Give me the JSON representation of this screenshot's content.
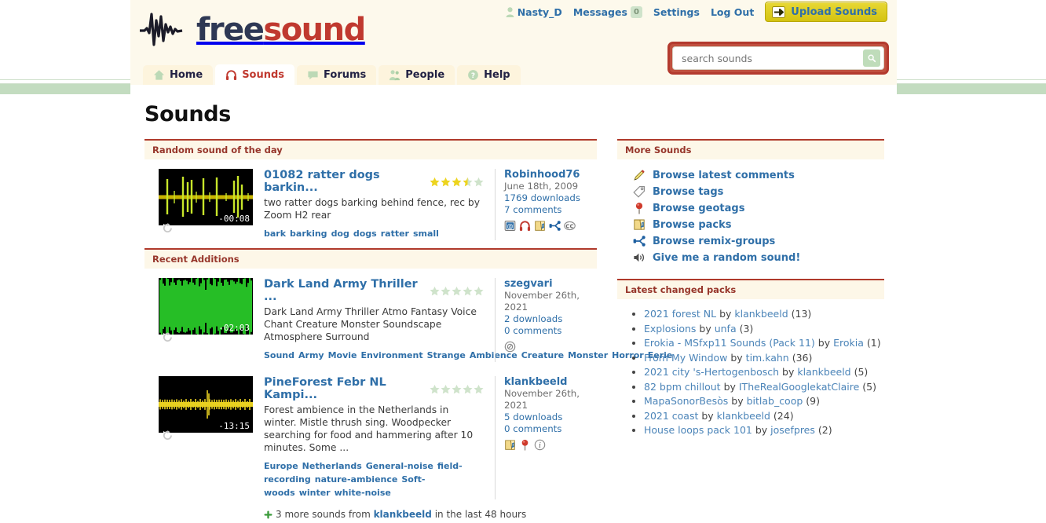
{
  "site": {
    "logo_free": "free",
    "logo_sound": "sound"
  },
  "userbar": {
    "username": "Nasty_D",
    "messages_label": "Messages",
    "messages_count": "0",
    "settings": "Settings",
    "logout": "Log Out",
    "upload": "Upload Sounds"
  },
  "search": {
    "placeholder": "search sounds",
    "value": ""
  },
  "tabs": [
    {
      "label": "Home",
      "icon": "home-icon",
      "active": false
    },
    {
      "label": "Sounds",
      "icon": "headphones-icon",
      "active": true
    },
    {
      "label": "Forums",
      "icon": "speech-bubble-icon",
      "active": false
    },
    {
      "label": "People",
      "icon": "people-icon",
      "active": false
    },
    {
      "label": "Help",
      "icon": "question-mark-icon",
      "active": false
    }
  ],
  "page": {
    "title": "Sounds"
  },
  "random_sound": {
    "section_title": "Random sound of the day",
    "title": "01082 ratter dogs barkin...",
    "rating": 3.5,
    "duration": "-00:08",
    "description": "two ratter dogs barking behind fence, rec by Zoom H2 rear",
    "tags": [
      "bark",
      "barking",
      "dog",
      "dogs",
      "ratter",
      "small"
    ],
    "user": "Robinhood76",
    "date": "June 18th, 2009",
    "downloads": "1769 downloads",
    "comments": "7 comments",
    "icons": [
      "geotag-mail-icon",
      "headphones-icon",
      "pack-icon",
      "remix-icon",
      "creative-commons-icon"
    ]
  },
  "recent_additions": {
    "section_title": "Recent Additions",
    "items": [
      {
        "title": "Dark Land Army Thriller ...",
        "rating": 0,
        "duration": "-02:03",
        "description": "Dark Land Army Thriller Atmo Fantasy Voice Chant Creature Monster Soundscape Atmosphere Surround",
        "tags": [
          "Sound",
          "Army",
          "Movie",
          "Environment",
          "Strange",
          "Ambience",
          "Creature",
          "Monster",
          "Horror",
          "Eerie"
        ],
        "user": "szegvari",
        "date": "November 26th, 2021",
        "downloads": "2 downloads",
        "comments": "0 comments",
        "icons": [
          "creative-commons-zero-icon"
        ],
        "more_sounds": null
      },
      {
        "title": "PineForest Febr NL Kampi...",
        "rating": 0,
        "duration": "-13:15",
        "description": "Forest ambience in the Netherlands in winter. Mistle thrush sing. Woodpecker searching for food and hammering after 10 minutes. Some ...",
        "tags": [
          "Europe",
          "Netherlands",
          "General-noise",
          "field-recording",
          "nature-ambience",
          "Soft-woods",
          "winter",
          "white-noise"
        ],
        "user": "klankbeeld",
        "date": "November 26th, 2021",
        "downloads": "5 downloads",
        "comments": "0 comments",
        "icons": [
          "pack-icon",
          "geotag-pin-icon",
          "info-icon"
        ],
        "more_sounds": {
          "prefix": "3 more sounds from",
          "user": "klankbeeld",
          "suffix": "in the last 48 hours"
        }
      }
    ]
  },
  "more_sounds": {
    "section_title": "More Sounds",
    "items": [
      {
        "label": "Browse latest comments",
        "icon": "pencil-icon"
      },
      {
        "label": "Browse tags",
        "icon": "tag-icon"
      },
      {
        "label": "Browse geotags",
        "icon": "geotag-pin-icon"
      },
      {
        "label": "Browse packs",
        "icon": "pack-icon"
      },
      {
        "label": "Browse remix-groups",
        "icon": "remix-icon"
      },
      {
        "label": "Give me a random sound!",
        "icon": "speaker-icon"
      }
    ]
  },
  "latest_packs": {
    "section_title": "Latest changed packs",
    "items": [
      {
        "name": "2021 forest NL",
        "by": "by",
        "user": "klankbeeld",
        "count": "(13)"
      },
      {
        "name": "Explosions",
        "by": "by",
        "user": "unfa",
        "count": "(3)"
      },
      {
        "name": "Erokia - MSfxp11 Sounds (Pack 11)",
        "by": "by",
        "user": "Erokia",
        "count": "(1)"
      },
      {
        "name": "From My Window",
        "by": "by",
        "user": "tim.kahn",
        "count": "(36)"
      },
      {
        "name": "2021 city 's-Hertogenbosch",
        "by": "by",
        "user": "klankbeeld",
        "count": "(5)"
      },
      {
        "name": "82 bpm chillout",
        "by": "by",
        "user": "ITheRealGooglekatClaire",
        "count": "(5)"
      },
      {
        "name": "MapaSonorBesòs",
        "by": "by",
        "user": "bitlab_coop",
        "count": "(9)"
      },
      {
        "name": "2021 coast",
        "by": "by",
        "user": "klankbeeld",
        "count": "(24)"
      },
      {
        "name": "House loops pack 101",
        "by": "by",
        "user": "josefpres",
        "count": "(2)"
      }
    ]
  },
  "colors": {
    "accent_red": "#b03a2c",
    "link_blue": "#2f6fa8",
    "cream": "#fdf9ec",
    "green_band": "#c3dcc0",
    "star_gold": "#edd41f",
    "star_empty": "#cfe3cb"
  }
}
